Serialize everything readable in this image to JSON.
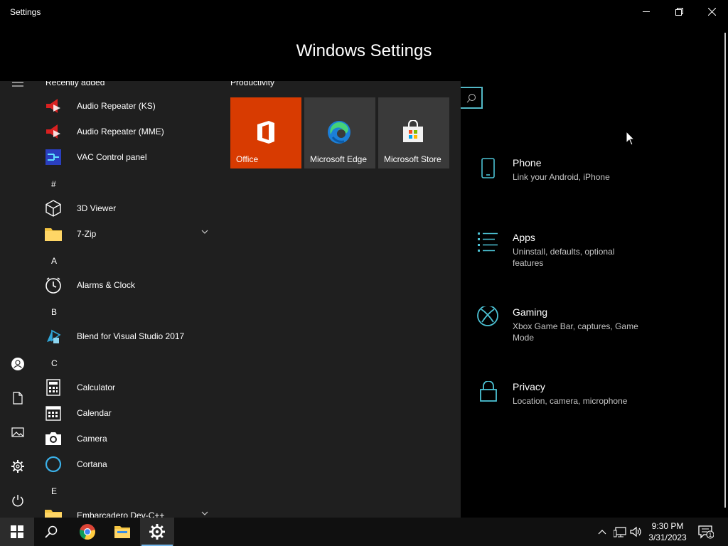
{
  "window": {
    "title": "Settings",
    "page_title": "Windows Settings"
  },
  "categories": [
    {
      "title": "Phone",
      "desc": "Link your Android, iPhone",
      "icon": "phone-icon"
    },
    {
      "title": "Apps",
      "desc": "Uninstall, defaults, optional features",
      "icon": "apps-list-icon"
    },
    {
      "title": "Gaming",
      "desc": "Xbox Game Bar, captures, Game Mode",
      "icon": "xbox-icon"
    },
    {
      "title": "Privacy",
      "desc": "Location, camera, microphone",
      "icon": "lock-icon"
    }
  ],
  "start_menu": {
    "recent_header": "Recently added",
    "apps": [
      {
        "label": "Audio Repeater (KS)",
        "icon": "speaker-red-icon"
      },
      {
        "label": "Audio Repeater (MME)",
        "icon": "speaker-red-icon"
      },
      {
        "label": "VAC Control panel",
        "icon": "vac-icon"
      },
      {
        "letter": "#"
      },
      {
        "label": "3D Viewer",
        "icon": "cube-icon"
      },
      {
        "label": "7-Zip",
        "icon": "folder-icon",
        "expandable": true
      },
      {
        "letter": "A"
      },
      {
        "label": "Alarms & Clock",
        "icon": "clock-icon"
      },
      {
        "letter": "B"
      },
      {
        "label": "Blend for Visual Studio 2017",
        "icon": "blend-icon"
      },
      {
        "letter": "C"
      },
      {
        "label": "Calculator",
        "icon": "calculator-icon"
      },
      {
        "label": "Calendar",
        "icon": "calendar-icon"
      },
      {
        "label": "Camera",
        "icon": "camera-icon"
      },
      {
        "label": "Cortana",
        "icon": "cortana-icon"
      },
      {
        "letter": "E"
      },
      {
        "label": "Embarcadero Dev-C++",
        "icon": "folder-icon",
        "expandable": true
      }
    ],
    "tiles_header": "Productivity",
    "tiles": [
      {
        "label": "Office",
        "icon": "office-icon",
        "color": "#d83b01"
      },
      {
        "label": "Microsoft Edge",
        "icon": "edge-icon",
        "color": "#3a3a3a"
      },
      {
        "label": "Microsoft Store",
        "icon": "store-icon",
        "color": "#3a3a3a"
      }
    ]
  },
  "taskbar": {
    "time": "9:30 PM",
    "date": "3/31/2023",
    "notification_count": "1"
  }
}
